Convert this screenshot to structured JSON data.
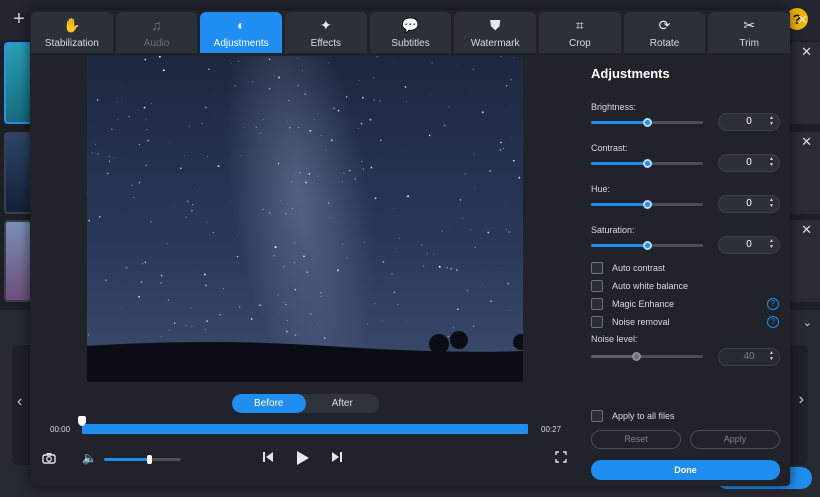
{
  "tabs": [
    {
      "label": "Stabilization",
      "icon": "hand-wave-icon",
      "active": false,
      "disabled": false
    },
    {
      "label": "Audio",
      "icon": "music-note-icon",
      "active": false,
      "disabled": true
    },
    {
      "label": "Adjustments",
      "icon": "contrast-icon",
      "active": true,
      "disabled": false
    },
    {
      "label": "Effects",
      "icon": "magic-wand-icon",
      "active": false,
      "disabled": false
    },
    {
      "label": "Subtitles",
      "icon": "speech-bubble-icon",
      "active": false,
      "disabled": false
    },
    {
      "label": "Watermark",
      "icon": "stamp-icon",
      "active": false,
      "disabled": false
    },
    {
      "label": "Crop",
      "icon": "crop-icon",
      "active": false,
      "disabled": false
    },
    {
      "label": "Rotate",
      "icon": "rotate-icon",
      "active": false,
      "disabled": false
    },
    {
      "label": "Trim",
      "icon": "scissors-icon",
      "active": false,
      "disabled": false
    }
  ],
  "preview": {
    "before_label": "Before",
    "after_label": "After",
    "selected": "Before"
  },
  "player": {
    "time_start": "00:00",
    "time_end": "00:27",
    "progress": 0.0,
    "volume": 0.6
  },
  "adjustments": {
    "title": "Adjustments",
    "sliders": [
      {
        "label": "Brightness:",
        "value": "0",
        "level": 0.5
      },
      {
        "label": "Contrast:",
        "value": "0",
        "level": 0.5
      },
      {
        "label": "Hue:",
        "value": "0",
        "level": 0.5
      },
      {
        "label": "Saturation:",
        "value": "0",
        "level": 0.5
      }
    ],
    "checkboxes": [
      {
        "label": "Auto contrast",
        "help": false
      },
      {
        "label": "Auto white balance",
        "help": false
      },
      {
        "label": "Magic Enhance",
        "help": true
      },
      {
        "label": "Noise removal",
        "help": true
      }
    ],
    "noise_level": {
      "label": "Noise level:",
      "value": "40",
      "level": 0.4
    },
    "apply_all_label": "Apply to all files",
    "reset_label": "Reset",
    "apply_label": "Apply",
    "done_label": "Done"
  },
  "colors": {
    "accent": "#1f8ef0",
    "panel": "#20232a",
    "tab": "#2c3038"
  }
}
